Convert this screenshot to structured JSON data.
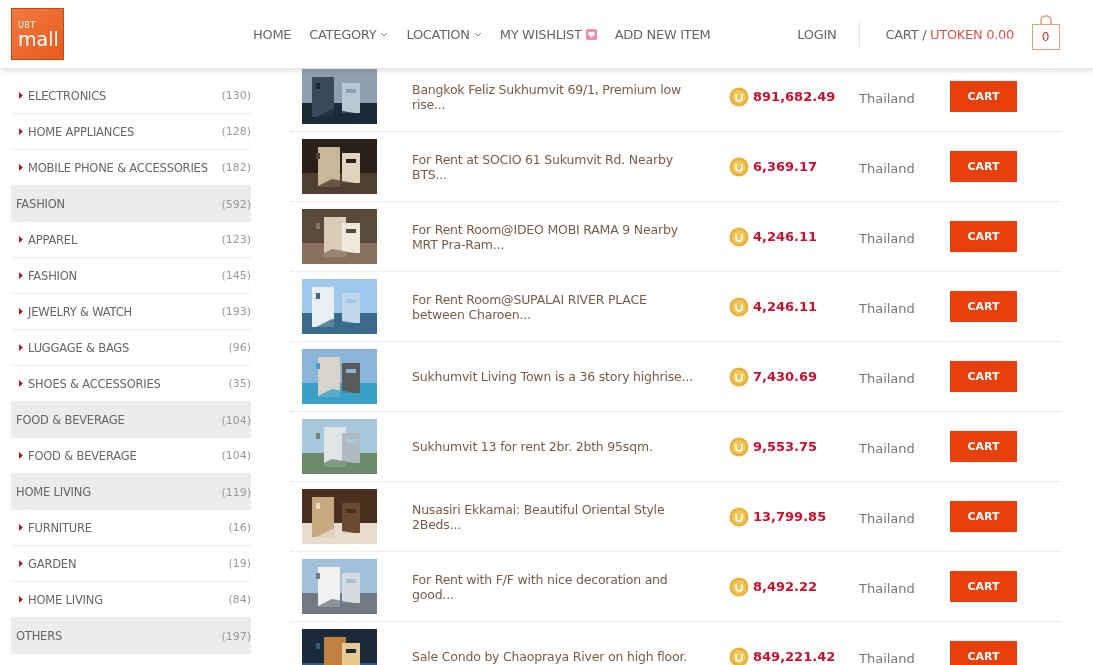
{
  "header": {
    "logo": {
      "top": "UBT",
      "main": "mall"
    },
    "nav": [
      {
        "label": "HOME",
        "dropdown": false
      },
      {
        "label": "CATEGORY",
        "dropdown": true
      },
      {
        "label": "LOCATION",
        "dropdown": true
      },
      {
        "label": "MY WISHLIST",
        "dropdown": false,
        "heart": true
      },
      {
        "label": "ADD NEW ITEM",
        "dropdown": false
      }
    ],
    "login": "LOGIN",
    "cart": {
      "label": "CART /",
      "amount": "UTOKEN 0.00",
      "count": "0"
    }
  },
  "sidebar": {
    "items": [
      {
        "kind": "item",
        "label": "ELECTRONICS",
        "count": "(130)"
      },
      {
        "kind": "item",
        "label": "HOME APPLIANCES",
        "count": "(128)"
      },
      {
        "kind": "item",
        "label": "MOBILE PHONE & ACCESSORIES",
        "count": "(182)"
      },
      {
        "kind": "group",
        "label": "FASHION",
        "count": "(592)"
      },
      {
        "kind": "item",
        "label": "APPAREL",
        "count": "(123)"
      },
      {
        "kind": "item",
        "label": "FASHION",
        "count": "(145)"
      },
      {
        "kind": "item",
        "label": "JEWELRY & WATCH",
        "count": "(193)"
      },
      {
        "kind": "item",
        "label": "LUGGAGE & BAGS",
        "count": "(96)"
      },
      {
        "kind": "item",
        "label": "SHOES & ACCESSORIES",
        "count": "(35)"
      },
      {
        "kind": "group",
        "label": "FOOD & BEVERAGE",
        "count": "(104)"
      },
      {
        "kind": "item",
        "label": "FOOD & BEVERAGE",
        "count": "(104)"
      },
      {
        "kind": "group",
        "label": "HOME LIVING",
        "count": "(119)"
      },
      {
        "kind": "item",
        "label": "FURNITURE",
        "count": "(16)"
      },
      {
        "kind": "item",
        "label": "GARDEN",
        "count": "(19)"
      },
      {
        "kind": "item",
        "label": "HOME LIVING",
        "count": "(84)"
      },
      {
        "kind": "group",
        "label": "OTHERS",
        "count": "(197)"
      }
    ]
  },
  "products": [
    {
      "title": "Bangkok Feliz Sukhumvit 69/1, Premium low rise...",
      "price": "891,682.49",
      "location": "Thailand",
      "button": "CART"
    },
    {
      "title": "For Rent at SOCIO 61 Sukumvit Rd. Nearby BTS...",
      "price": "6,369.17",
      "location": "Thailand",
      "button": "CART"
    },
    {
      "title": "For Rent Room@IDEO MOBI RAMA 9 Nearby MRT Pra-Ram...",
      "price": "4,246.11",
      "location": "Thailand",
      "button": "CART"
    },
    {
      "title": "For Rent Room@SUPALAI RIVER PLACE between Charoen...",
      "price": "4,246.11",
      "location": "Thailand",
      "button": "CART"
    },
    {
      "title": "Sukhumvit Living Town is a 36 story highrise...",
      "price": "7,430.69",
      "location": "Thailand",
      "button": "CART"
    },
    {
      "title": "Sukhumvit 13 for rent 2br. 2bth 95sqm.",
      "price": "9,553.75",
      "location": "Thailand",
      "button": "CART"
    },
    {
      "title": "Nusasiri Ekkamai: Beautiful Oriental Style 2Beds...",
      "price": "13,799.85",
      "location": "Thailand",
      "button": "CART"
    },
    {
      "title": "For Rent with F/F with nice decoration and good...",
      "price": "8,492.22",
      "location": "Thailand",
      "button": "CART"
    },
    {
      "title": "Sale Condo by Chaopraya River on high floor.",
      "price": "849,221.42",
      "location": "Thailand",
      "button": "CART"
    }
  ]
}
